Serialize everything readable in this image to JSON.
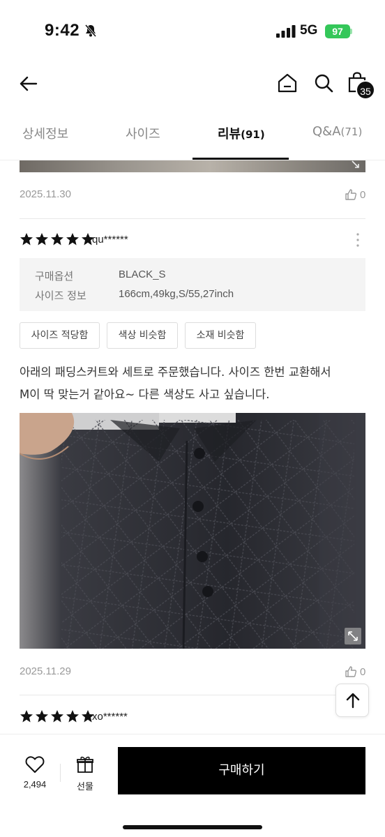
{
  "status": {
    "time": "9:42",
    "network": "5G",
    "battery": "97"
  },
  "header": {
    "cart_count": "35"
  },
  "tabs": [
    {
      "label": "상세정보",
      "count": ""
    },
    {
      "label": "사이즈",
      "count": ""
    },
    {
      "label": "리뷰",
      "count": "(91)"
    },
    {
      "label": "Q&A",
      "count": "(71)"
    }
  ],
  "review_prev": {
    "date": "2025.11.30",
    "likes": "0"
  },
  "review": {
    "rating": 5,
    "user": "qu******",
    "option_key": "구매옵션",
    "option_value": "BLACK_S",
    "size_key": "사이즈 정보",
    "size_value": "166cm,49kg,S/55,27inch",
    "tags": [
      "사이즈 적당함",
      "색상 비슷함",
      "소재 비슷함"
    ],
    "text_line1": "아래의 패딩스커트와 세트로 주문했습니다. 사이즈 한번 교환해서",
    "text_line2": "M이 딱 맞는거 같아요~ 다른 색상도 사고 싶습니다.",
    "date": "2025.11.29",
    "likes": "0"
  },
  "review_next": {
    "rating": 5,
    "user": "xo******"
  },
  "bottom": {
    "wish_count": "2,494",
    "gift_label": "선물",
    "buy_label": "구매하기"
  },
  "colors": {
    "accent": "#000000",
    "battery": "#34c759",
    "star": "#111111"
  }
}
